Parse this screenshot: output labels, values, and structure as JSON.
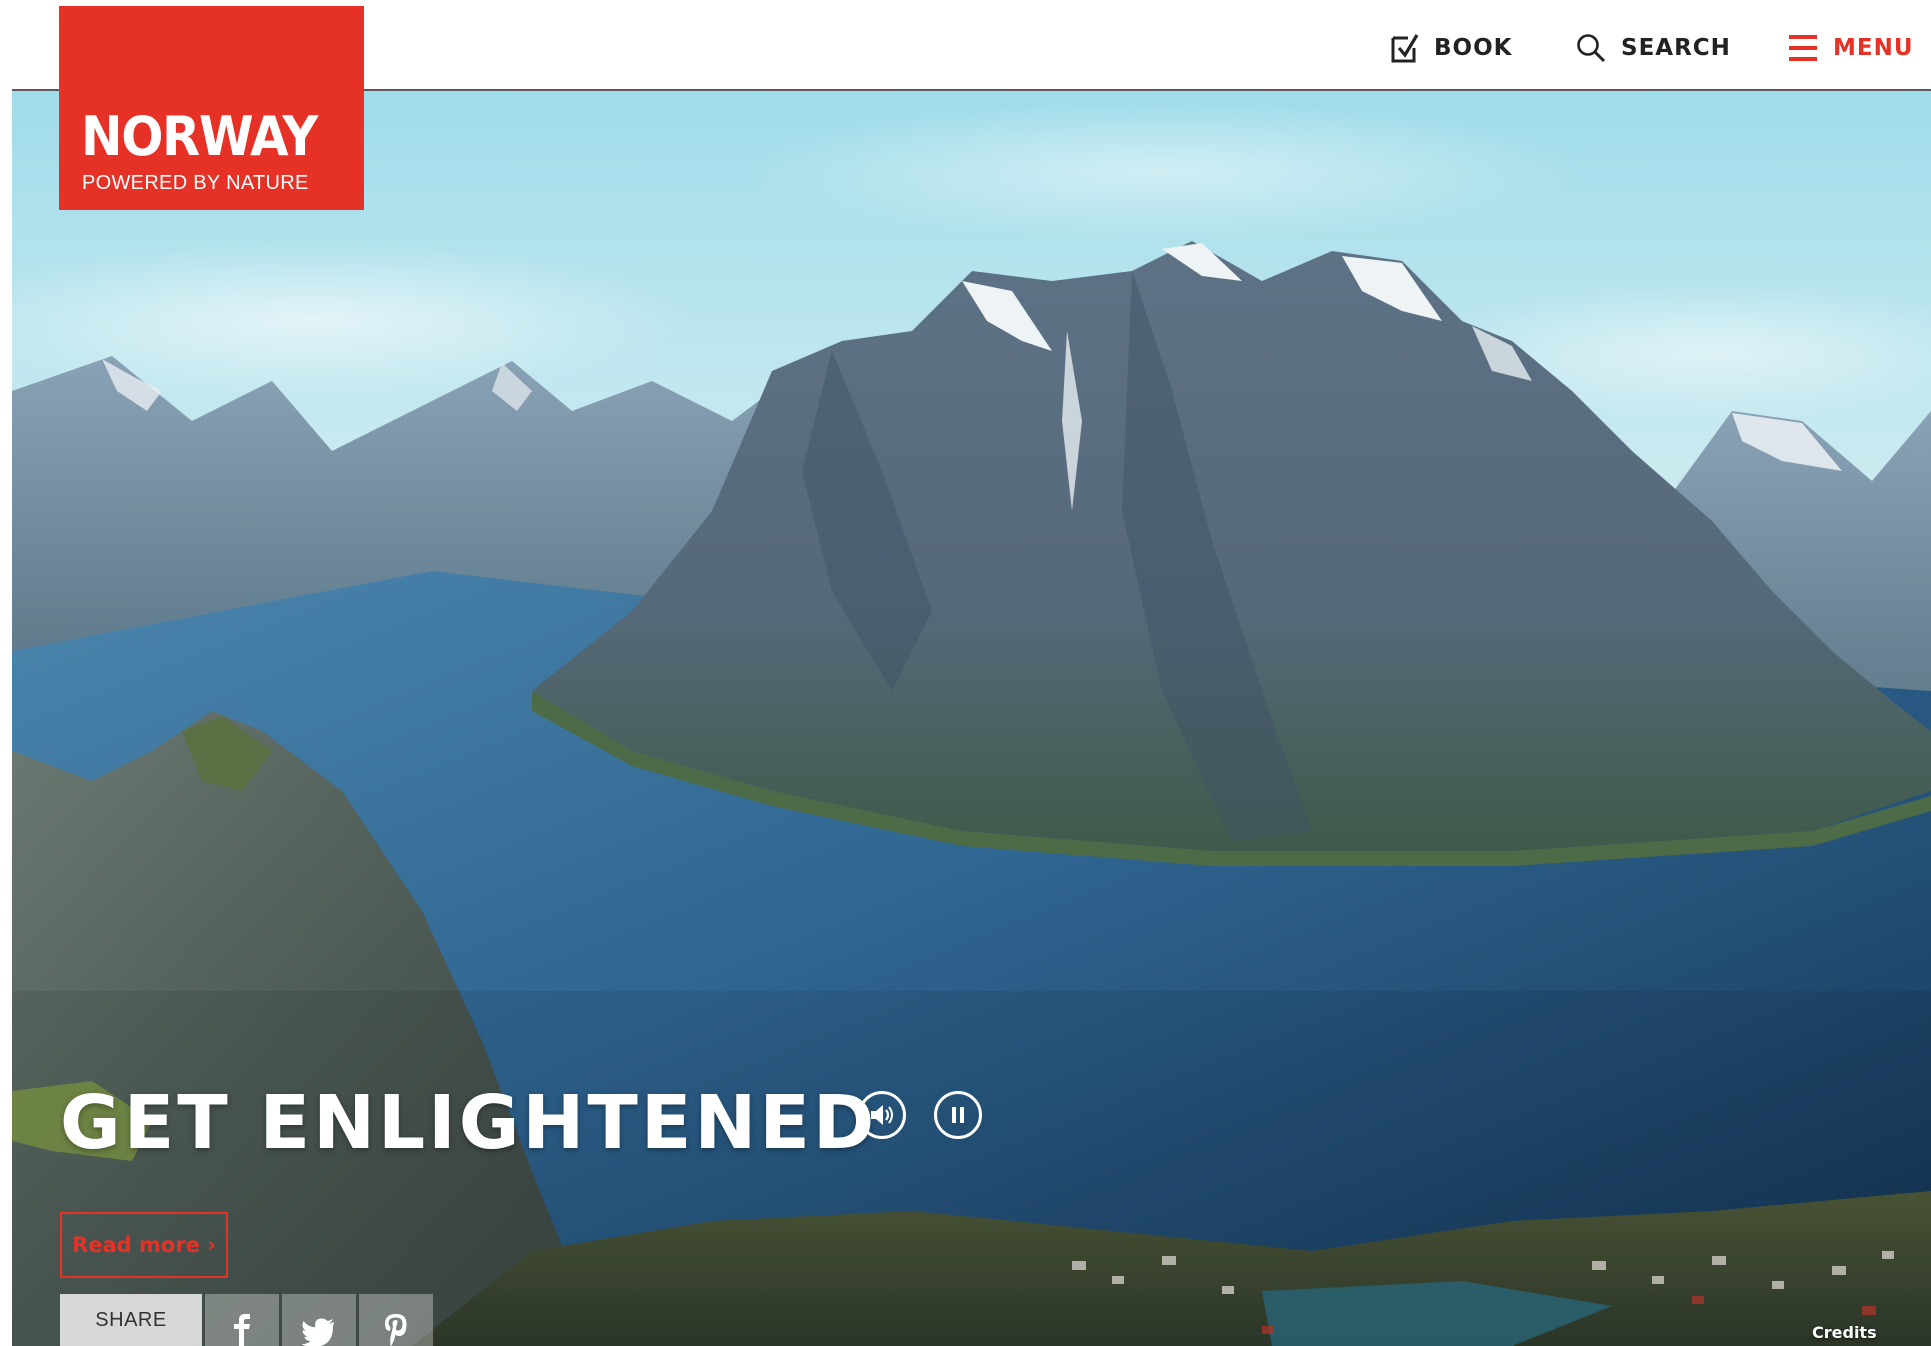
{
  "brand": {
    "name": "NORWAY",
    "tagline": "POWERED BY NATURE",
    "color": "#e63226"
  },
  "nav": {
    "book": {
      "label": "BOOK",
      "icon": "checkbox-icon"
    },
    "search": {
      "label": "SEARCH",
      "icon": "search-icon"
    },
    "menu": {
      "label": "MENU",
      "icon": "hamburger-icon"
    }
  },
  "hero": {
    "headline": "GET ENLIGHTENED",
    "read_more": "Read more ›",
    "controls": {
      "sound_icon": "speaker-icon",
      "pause_icon": "pause-icon"
    },
    "share": {
      "label": "SHARE",
      "networks": [
        "facebook-icon",
        "twitter-icon",
        "pinterest-icon"
      ]
    },
    "credits": "Credits"
  }
}
